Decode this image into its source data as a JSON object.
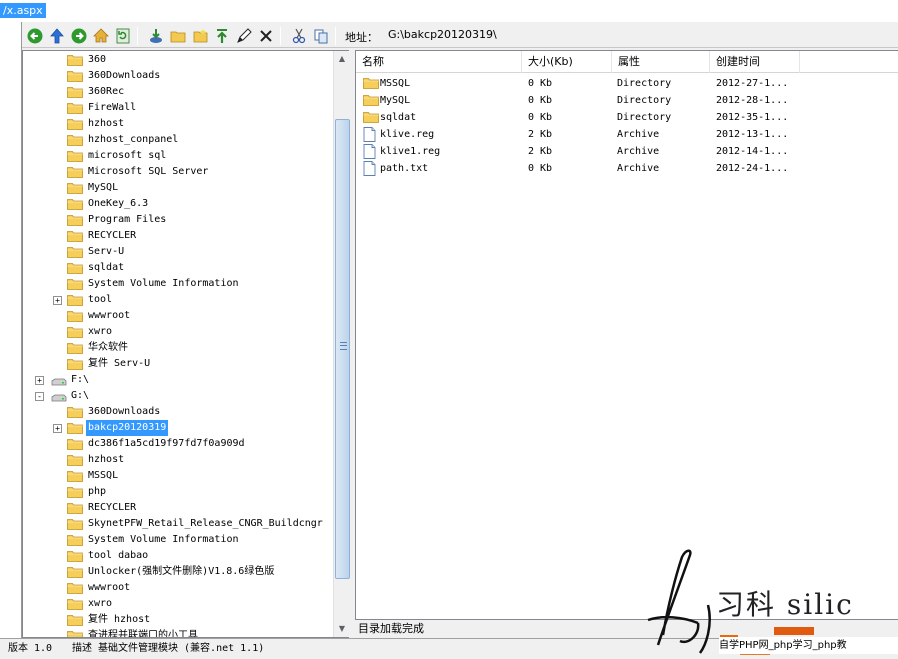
{
  "titlebar": {
    "url_fragment": "/x.aspx"
  },
  "toolbar": {
    "address_label": "地址：",
    "address_value": "G:\\bakcp20120319\\",
    "icons": [
      "back-icon",
      "up-icon",
      "forward-icon",
      "home-icon",
      "refresh-icon",
      "download-icon",
      "new-folder-icon",
      "new-file-icon",
      "upload-icon",
      "edit-icon",
      "delete-icon",
      "cut-icon",
      "copy-icon"
    ]
  },
  "tree": {
    "items": [
      {
        "label": "360",
        "indent": 2
      },
      {
        "label": "360Downloads",
        "indent": 2
      },
      {
        "label": "360Rec",
        "indent": 2
      },
      {
        "label": "FireWall",
        "indent": 2
      },
      {
        "label": "hzhost",
        "indent": 2
      },
      {
        "label": "hzhost_conpanel",
        "indent": 2
      },
      {
        "label": "microsoft sql",
        "indent": 2
      },
      {
        "label": "Microsoft SQL Server",
        "indent": 2
      },
      {
        "label": "MySQL",
        "indent": 2
      },
      {
        "label": "OneKey_6.3",
        "indent": 2
      },
      {
        "label": "Program Files",
        "indent": 2
      },
      {
        "label": "RECYCLER",
        "indent": 2
      },
      {
        "label": "Serv-U",
        "indent": 2
      },
      {
        "label": "sqldat",
        "indent": 2
      },
      {
        "label": "System Volume Information",
        "indent": 2
      },
      {
        "label": "tool",
        "indent": 2,
        "expander": "+"
      },
      {
        "label": "wwwroot",
        "indent": 2
      },
      {
        "label": "xwro",
        "indent": 2
      },
      {
        "label": "华众软件",
        "indent": 2
      },
      {
        "label": "复件 Serv-U",
        "indent": 2
      },
      {
        "label": "F:\\",
        "indent": 1,
        "drive": true,
        "expander": "+"
      },
      {
        "label": "G:\\",
        "indent": 1,
        "drive": true,
        "expander": "-"
      },
      {
        "label": "360Downloads",
        "indent": 2
      },
      {
        "label": "bakcp20120319",
        "indent": 2,
        "expander": "+",
        "selected": true
      },
      {
        "label": "dc386f1a5cd19f97fd7f0a909d",
        "indent": 2
      },
      {
        "label": "hzhost",
        "indent": 2
      },
      {
        "label": "MSSQL",
        "indent": 2
      },
      {
        "label": "php",
        "indent": 2
      },
      {
        "label": "RECYCLER",
        "indent": 2
      },
      {
        "label": "SkynetPFW_Retail_Release_CNGR_Buildcngr",
        "indent": 2
      },
      {
        "label": "System Volume Information",
        "indent": 2
      },
      {
        "label": "tool dabao",
        "indent": 2
      },
      {
        "label": "Unlocker(强制文件删除)V1.8.6绿色版",
        "indent": 2
      },
      {
        "label": "wwwroot",
        "indent": 2
      },
      {
        "label": "xwro",
        "indent": 2
      },
      {
        "label": "复件 hzhost",
        "indent": 2
      },
      {
        "label": "查进程并联端口的小工具",
        "indent": 2
      }
    ]
  },
  "list": {
    "columns": [
      "名称",
      "大小(Kb)",
      "属性",
      "创建时间"
    ],
    "rows": [
      {
        "name": "MSSQL",
        "size": "0 Kb",
        "attr": "Directory",
        "created": "2012-27-1...",
        "type": "folder"
      },
      {
        "name": "MySQL",
        "size": "0 Kb",
        "attr": "Directory",
        "created": "2012-28-1...",
        "type": "folder"
      },
      {
        "name": "sqldat",
        "size": "0 Kb",
        "attr": "Directory",
        "created": "2012-35-1...",
        "type": "folder"
      },
      {
        "name": "klive.reg",
        "size": "2 Kb",
        "attr": "Archive",
        "created": "2012-13-1...",
        "type": "file"
      },
      {
        "name": "klive1.reg",
        "size": "2 Kb",
        "attr": "Archive",
        "created": "2012-14-1...",
        "type": "file"
      },
      {
        "name": "path.txt",
        "size": "0 Kb",
        "attr": "Archive",
        "created": "2012-24-1...",
        "type": "file"
      }
    ]
  },
  "status": {
    "text": "目录加载完成"
  },
  "bottom": {
    "version": "版本 1.0",
    "description": "描述 基础文件管理模块 (兼容.net 1.1)"
  },
  "watermark": {
    "text": "习科 silic",
    "bar_text": "自学PHP网_php学习_php教"
  }
}
